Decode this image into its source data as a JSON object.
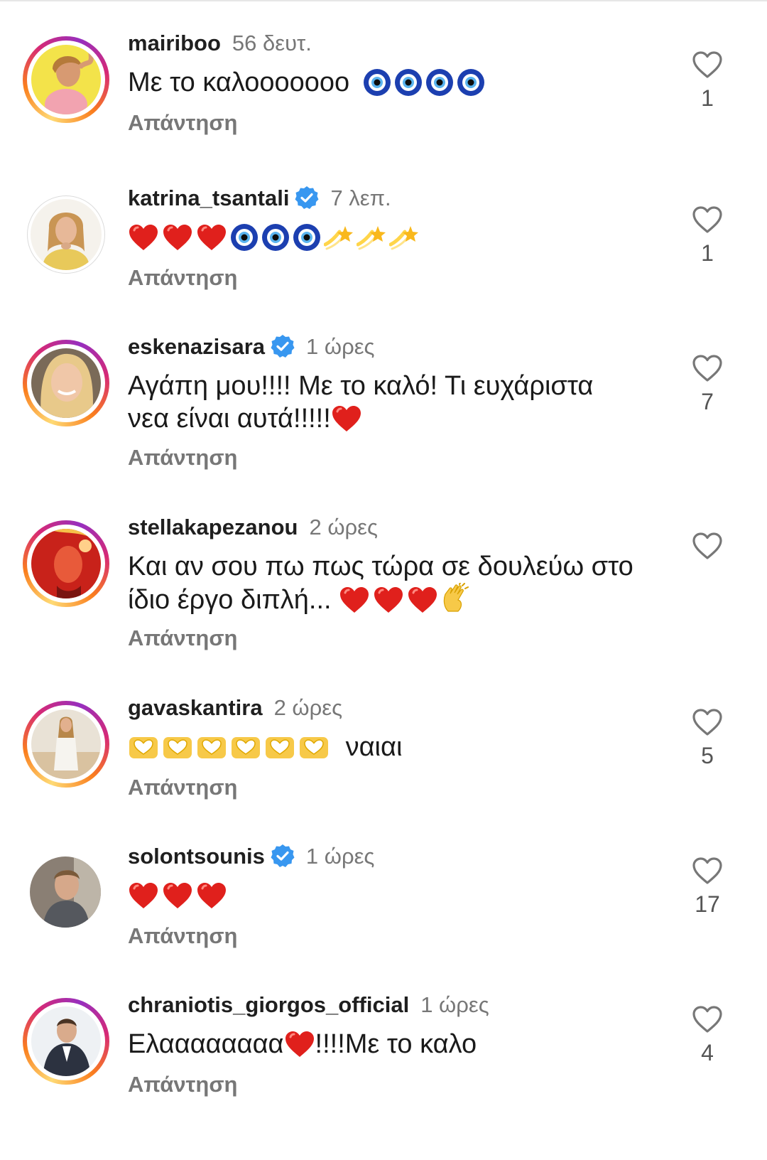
{
  "reply_label": "Απάντηση",
  "comments": [
    {
      "username": "mairiboo",
      "time": "56 δευτ.",
      "text": "Με το καλοοοοοοο",
      "likes": "1",
      "verified": false
    },
    {
      "username": "katrina_tsantali",
      "time": "7 λεπ.",
      "text": "",
      "likes": "1",
      "verified": true
    },
    {
      "username": "eskenazisara",
      "time": "1 ώρες",
      "text_line1": "Αγάπη μου!!!! Με το καλό! Τι ευχάριστα",
      "text_line2": "νεα είναι αυτά!!!!!",
      "likes": "7",
      "verified": true
    },
    {
      "username": "stellakapezanou",
      "time": "2 ώρες",
      "text_line1": "Και αν σου πω πως τώρα σε δουλεύω στο",
      "text_line2": "ίδιο έργο διπλή...",
      "likes": "",
      "verified": false
    },
    {
      "username": "gavaskantira",
      "time": "2 ώρες",
      "text": "ναιαι",
      "likes": "5",
      "verified": false
    },
    {
      "username": "solontsounis",
      "time": "1 ώρες",
      "text": "",
      "likes": "17",
      "verified": true
    },
    {
      "username": "chraniotis_giorgos_official",
      "time": "1 ώρες",
      "text_a": "Ελαααααααα",
      "text_b": "!!!!Με το καλο",
      "likes": "4",
      "verified": false
    }
  ],
  "colors": {
    "ring": "#d62976",
    "verified": "#3897f0",
    "muted": "#777777",
    "heart": "#e0201c",
    "nazar": "#1c3fb0"
  },
  "icons": [
    "heart-outline-icon",
    "verified-badge-icon",
    "nazar-emoji",
    "red-heart-emoji",
    "shooting-star-emoji",
    "heart-hands-emoji",
    "clapping-hands-emoji"
  ]
}
